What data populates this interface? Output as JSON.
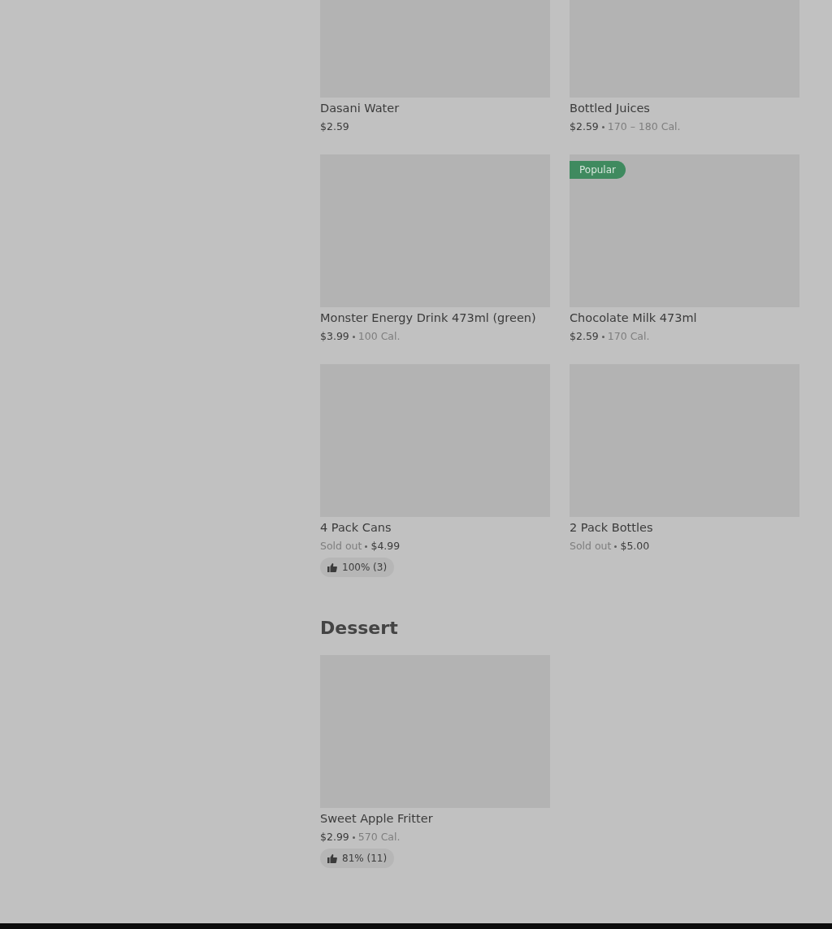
{
  "sections": [
    {
      "rows": [
        {
          "items": [
            {
              "name": "Dasani Water",
              "meta": [
                {
                  "kind": "price",
                  "text": "$2.59"
                }
              ]
            },
            {
              "name": "Bottled Juices",
              "meta": [
                {
                  "kind": "price",
                  "text": "$2.59"
                },
                {
                  "kind": "note",
                  "text": "170 – 180 Cal."
                }
              ]
            }
          ]
        },
        {
          "items": [
            {
              "name": "Monster Energy Drink 473ml (green)",
              "meta": [
                {
                  "kind": "price",
                  "text": "$3.99"
                },
                {
                  "kind": "note",
                  "text": "100 Cal."
                }
              ]
            },
            {
              "name": "Chocolate Milk 473ml",
              "badge": "Popular",
              "meta": [
                {
                  "kind": "price",
                  "text": "$2.59"
                },
                {
                  "kind": "note",
                  "text": "170 Cal."
                }
              ]
            }
          ]
        },
        {
          "items": [
            {
              "name": "4 Pack Cans",
              "meta": [
                {
                  "kind": "note",
                  "text": "Sold out"
                },
                {
                  "kind": "price",
                  "text": "$4.99"
                }
              ],
              "rating": "100% (3)"
            },
            {
              "name": "2 Pack Bottles",
              "meta": [
                {
                  "kind": "note",
                  "text": "Sold out"
                },
                {
                  "kind": "price",
                  "text": "$5.00"
                }
              ]
            }
          ]
        }
      ]
    },
    {
      "title": "Dessert",
      "rows": [
        {
          "items": [
            {
              "name": "Sweet Apple Fritter",
              "meta": [
                {
                  "kind": "price",
                  "text": "$2.99"
                },
                {
                  "kind": "note",
                  "text": "570 Cal."
                }
              ],
              "rating": "81% (11)"
            }
          ]
        }
      ]
    }
  ]
}
